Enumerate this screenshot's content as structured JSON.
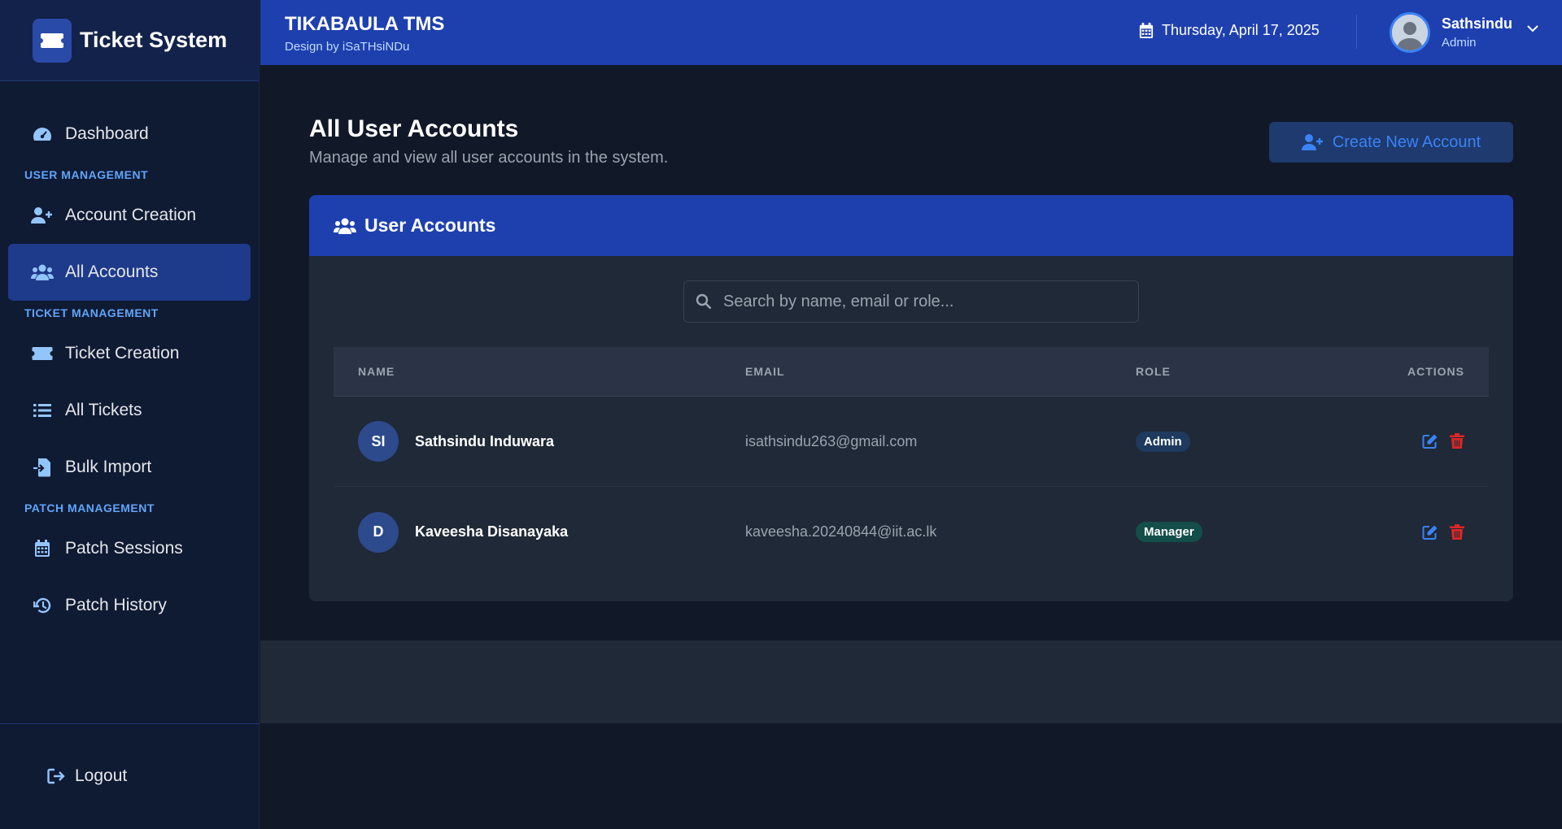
{
  "sidebar": {
    "brand": "Ticket System",
    "items": {
      "dashboard": "Dashboard",
      "account_creation": "Account Creation",
      "all_accounts": "All Accounts",
      "ticket_creation": "Ticket Creation",
      "all_tickets": "All Tickets",
      "bulk_import": "Bulk Import",
      "patch_sessions": "Patch Sessions",
      "patch_history": "Patch History"
    },
    "sections": {
      "user_management": "USER MANAGEMENT",
      "ticket_management": "TICKET MANAGEMENT",
      "patch_management": "PATCH MANAGEMENT"
    },
    "logout": "Logout",
    "active_item": "All Accounts"
  },
  "header": {
    "title": "TIKABAULA TMS",
    "subtitle": "Design by iSaTHsiNDu",
    "date": "Thursday, April 17, 2025",
    "user_name": "Sathsindu",
    "user_role": "Admin"
  },
  "page": {
    "title": "All User Accounts",
    "subtitle": "Manage and view all user accounts in the system.",
    "create_button": "Create New Account"
  },
  "card": {
    "title": "User Accounts",
    "search_placeholder": "Search by name, email or role...",
    "columns": {
      "name": "NAME",
      "email": "EMAIL",
      "role": "ROLE",
      "actions": "ACTIONS"
    },
    "rows": [
      {
        "initials": "SI",
        "name": "Sathsindu Induwara",
        "email": "isathsindu263@gmail.com",
        "role": "Admin"
      },
      {
        "initials": "D",
        "name": "Kaveesha Disanayaka",
        "email": "kaveesha.20240844@iit.ac.lk",
        "role": "Manager"
      }
    ]
  },
  "colors": {
    "accent": "#1e40af",
    "sidebar_bg": "#0f1a33",
    "link_blue": "#3b82f6",
    "delete_red": "#dc2626",
    "section_label": "#60a5fa"
  },
  "icons": {
    "brand": "ticket-icon",
    "dashboard": "gauge-icon",
    "account_creation": "user-plus-icon",
    "all_accounts": "users-icon",
    "ticket_creation": "ticket-icon",
    "all_tickets": "list-icon",
    "bulk_import": "file-import-icon",
    "patch_sessions": "calendar-icon",
    "patch_history": "history-icon",
    "logout": "sign-out-icon",
    "edit": "edit-icon",
    "delete": "trash-icon"
  }
}
